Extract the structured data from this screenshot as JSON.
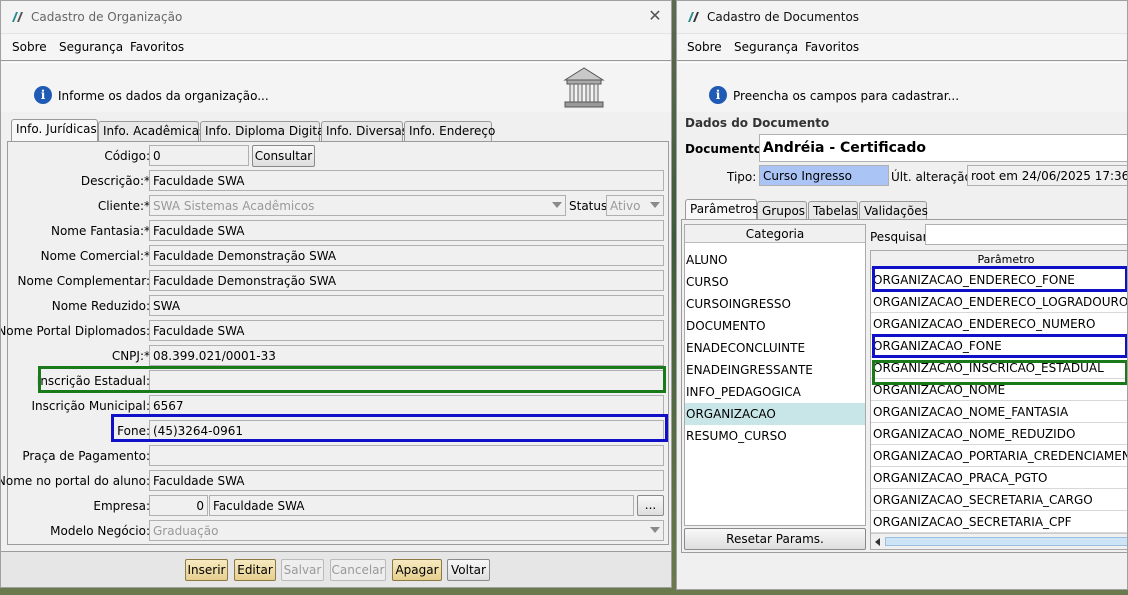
{
  "left": {
    "title": "Cadastro de Organização",
    "menu": [
      "Sobre",
      "Segurança",
      "Favoritos"
    ],
    "info": "Informe os dados da organização...",
    "tabs": [
      "Info. Jurídicas",
      "Info. Acadêmicas",
      "Info. Diploma Digital",
      "Info. Diversas",
      "Info. Endereço"
    ],
    "fields": {
      "codigo": {
        "label": "Código:",
        "value": "0"
      },
      "consultar": "Consultar",
      "descricao": {
        "label": "Descrição:*",
        "value": "Faculdade SWA"
      },
      "cliente": {
        "label": "Cliente:*",
        "value": "SWA Sistemas Acadêmicos"
      },
      "status": {
        "label": "Status:",
        "value": "Ativo"
      },
      "nome_fantasia": {
        "label": "Nome Fantasia:*",
        "value": "Faculdade SWA"
      },
      "nome_comercial": {
        "label": "Nome Comercial:*",
        "value": "Faculdade Demonstração SWA"
      },
      "nome_complementar": {
        "label": "Nome Complementar:",
        "value": "Faculdade Demonstração SWA"
      },
      "nome_reduzido": {
        "label": "Nome Reduzido:",
        "value": "SWA"
      },
      "nome_portal": {
        "label": "Nome Portal Diplomados:",
        "value": "Faculdade SWA"
      },
      "cnpj": {
        "label": "CNPJ:*",
        "value": "08.399.021/0001-33"
      },
      "insc_estadual": {
        "label": "Inscrição Estadual:",
        "value": ""
      },
      "insc_municipal": {
        "label": "Inscrição Municipal:",
        "value": "6567"
      },
      "fone": {
        "label": "Fone:",
        "value": "(45)3264-0961"
      },
      "praca": {
        "label": "Praça de Pagamento:",
        "value": ""
      },
      "nome_aluno": {
        "label": "Nome no portal do aluno:",
        "value": "Faculdade SWA"
      },
      "empresa": {
        "label": "Empresa:",
        "code": "0",
        "value": "Faculdade SWA",
        "ellipsis": "..."
      },
      "modelo": {
        "label": "Modelo Negócio:",
        "value": "Graduação"
      }
    },
    "buttons": {
      "inserir": "Inserir",
      "editar": "Editar",
      "salvar": "Salvar",
      "cancelar": "Cancelar",
      "apagar": "Apagar",
      "voltar": "Voltar"
    }
  },
  "right": {
    "title": "Cadastro de Documentos",
    "menu": [
      "Sobre",
      "Segurança",
      "Favoritos"
    ],
    "info": "Preencha os campos para cadastrar...",
    "group_title": "Dados do Documento",
    "documento_label": "Documento:",
    "documento_value": "Andréia - Certificado",
    "tipo_label": "Tipo:",
    "tipo_value": "Curso Ingresso",
    "ult_label": "Últ. alteração:",
    "ult_value": "root em 24/06/2025 17:36",
    "tabs": [
      "Parâmetros",
      "Grupos",
      "Tabelas",
      "Validações"
    ],
    "categoria_header": "Categoria",
    "categorias": [
      "ALUNO",
      "CURSO",
      "CURSOINGRESSO",
      "DOCUMENTO",
      "ENADECONCLUINTE",
      "ENADEINGRESSANTE",
      "INFO_PEDAGOGICA",
      "ORGANIZACAO",
      "RESUMO_CURSO"
    ],
    "selected_categoria": "ORGANIZACAO",
    "pesquisar_label": "Pesquisar:",
    "parametro_header": "Parâmetro",
    "parametros": [
      "ORGANIZACAO_ENDERECO_FONE",
      "ORGANIZACAO_ENDERECO_LOGRADOURO",
      "ORGANIZACAO_ENDERECO_NUMERO",
      "ORGANIZACAO_FONE",
      "ORGANIZACAO_INSCRICAO_ESTADUAL",
      "ORGANIZACAO_NOME",
      "ORGANIZACAO_NOME_FANTASIA",
      "ORGANIZACAO_NOME_REDUZIDO",
      "ORGANIZACAO_PORTARIA_CREDENCIAMENTO",
      "ORGANIZACAO_PRACA_PGTO",
      "ORGANIZACAO_SECRETARIA_CARGO",
      "ORGANIZACAO_SECRETARIA_CPF"
    ],
    "reset_button": "Resetar Params."
  },
  "colors": {
    "highlight_blue": "#1010c8",
    "highlight_green": "#1a7a1a",
    "selected_row": "#c8e6e8",
    "tipo_bg": "#a9c4f5",
    "info_icon": "#1f5ab5"
  }
}
